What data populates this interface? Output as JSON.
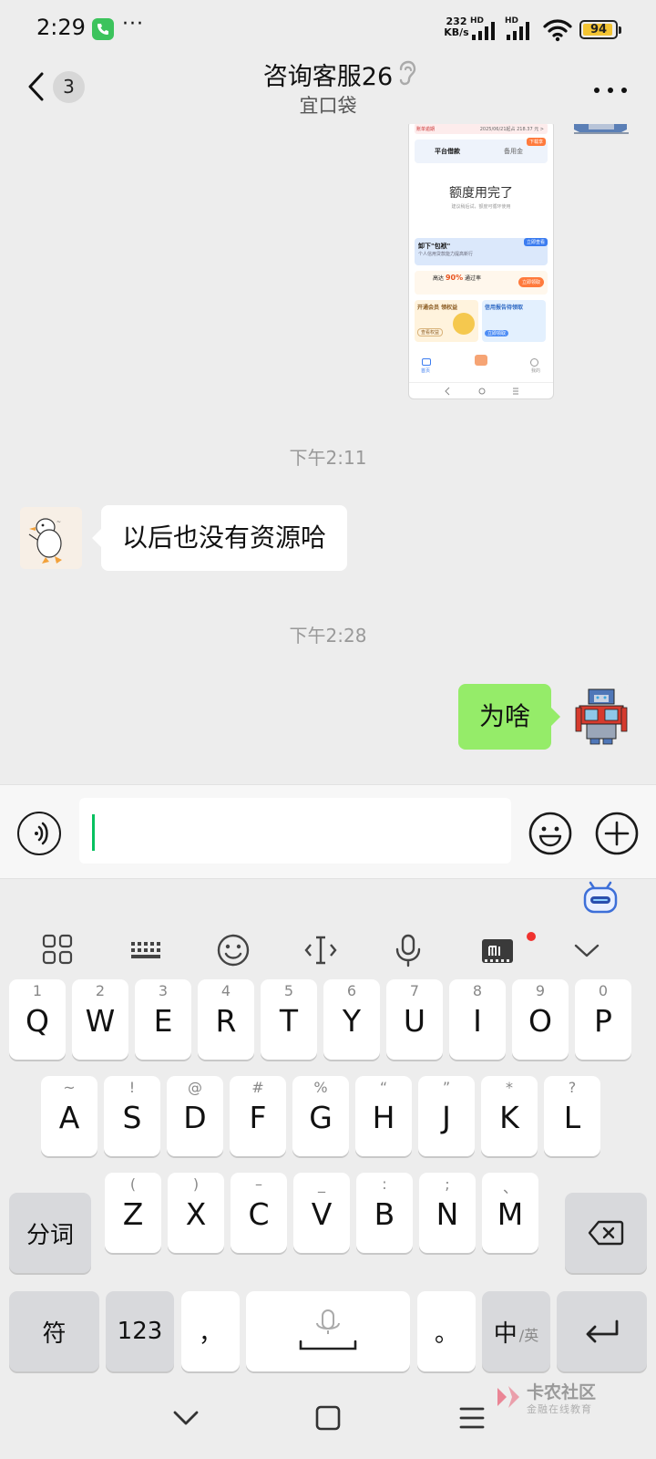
{
  "status_bar": {
    "time": "2:29",
    "dots": "···",
    "net_speed_value": "232",
    "net_speed_unit": "KB/s",
    "network_tag": "HD",
    "battery": "94"
  },
  "nav": {
    "unread_count": "3",
    "title": "咨询客服26",
    "subtitle": "宜口袋"
  },
  "screenshot_card": {
    "notice": "账单逾期",
    "notice_right": "2025/06/21起占 218.37 元 >",
    "tab_left": "平台借款",
    "tab_right": "备用金",
    "tab_badge": "下载享",
    "quota_text": "额度用完了",
    "quota_note": "建议稍后试，额度可循环使用",
    "banner_title": "卸下\"包袱\"",
    "banner_note": "个人信用贷款能力提高新行",
    "banner_tag": "立即查看",
    "promo_prefix": "高达",
    "promo_highlight": "90%",
    "promo_suffix": "通过率",
    "promo_button": "立即领取",
    "tile_left": "开通会员 领权益",
    "tile_left_btn": "查看权益",
    "tile_right": "信用报告待领取",
    "tile_right_btn": "立即领取",
    "tab_home": "首页",
    "tab_mine": "我的"
  },
  "messages": [
    {
      "type": "time",
      "text": "下午2:11"
    },
    {
      "type": "incoming",
      "text": "以后也没有资源哈"
    },
    {
      "type": "time",
      "text": "下午2:28"
    },
    {
      "type": "outgoing",
      "text": "为啥"
    }
  ],
  "keyboard": {
    "row1": [
      {
        "hint": "1",
        "key": "Q"
      },
      {
        "hint": "2",
        "key": "W"
      },
      {
        "hint": "3",
        "key": "E"
      },
      {
        "hint": "4",
        "key": "R"
      },
      {
        "hint": "5",
        "key": "T"
      },
      {
        "hint": "6",
        "key": "Y"
      },
      {
        "hint": "7",
        "key": "U"
      },
      {
        "hint": "8",
        "key": "I"
      },
      {
        "hint": "9",
        "key": "O"
      },
      {
        "hint": "0",
        "key": "P"
      }
    ],
    "row2": [
      {
        "hint": "~",
        "key": "A"
      },
      {
        "hint": "!",
        "key": "S"
      },
      {
        "hint": "@",
        "key": "D"
      },
      {
        "hint": "#",
        "key": "F"
      },
      {
        "hint": "%",
        "key": "G"
      },
      {
        "hint": "“",
        "key": "H"
      },
      {
        "hint": "”",
        "key": "J"
      },
      {
        "hint": "*",
        "key": "K"
      },
      {
        "hint": "?",
        "key": "L"
      }
    ],
    "row3": [
      {
        "hint": "(",
        "key": "Z"
      },
      {
        "hint": ")",
        "key": "X"
      },
      {
        "hint": "–",
        "key": "C"
      },
      {
        "hint": "_",
        "key": "V"
      },
      {
        "hint": ":",
        "key": "B"
      },
      {
        "hint": ";",
        "key": "N"
      },
      {
        "hint": "、",
        "key": "M"
      }
    ],
    "segment_label": "分词",
    "symbols_label": "符",
    "numbers_label": "123",
    "comma_label": "，",
    "period_label": "。",
    "lang_label": "中",
    "lang_sub": "/英"
  },
  "watermark": {
    "main": "卡农社区",
    "sub": "金融在线教育"
  },
  "colors": {
    "outgoing_bubble": "#95ec69",
    "caret": "#07c160",
    "battery_fill": "#f3c433",
    "background": "#ededed"
  }
}
